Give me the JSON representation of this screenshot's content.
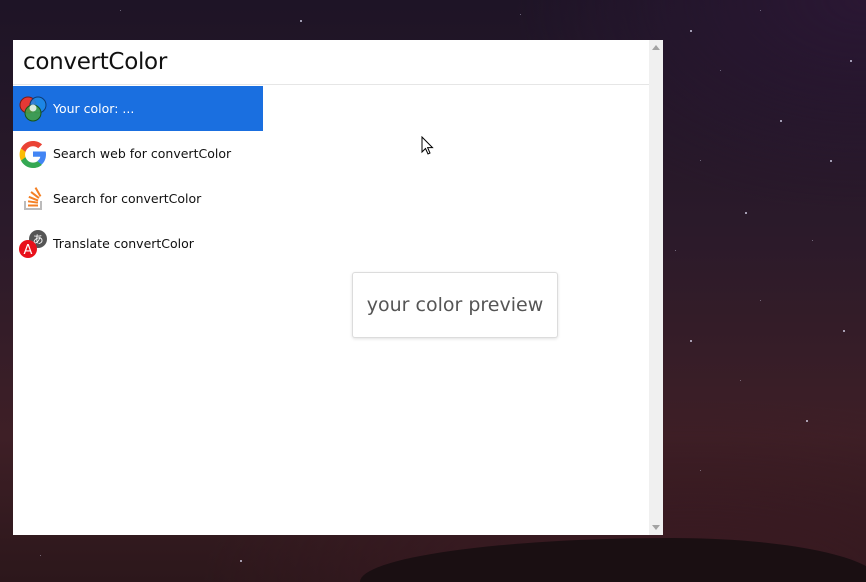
{
  "window": {
    "query": "convertColor"
  },
  "results": [
    {
      "label": "Your color: ...",
      "icon": "color-circles-icon",
      "selected": true
    },
    {
      "label": "Search web for convertColor",
      "icon": "google-icon",
      "selected": false
    },
    {
      "label": "Search for convertColor",
      "icon": "stackoverflow-icon",
      "selected": false
    },
    {
      "label": "Translate convertColor",
      "icon": "translate-icon",
      "selected": false
    }
  ],
  "preview": {
    "text": "your color preview"
  },
  "colors": {
    "selection": "#1a6fe0",
    "panel_bg": "#ffffff",
    "scrollbar_bg": "#f0f0f0"
  }
}
